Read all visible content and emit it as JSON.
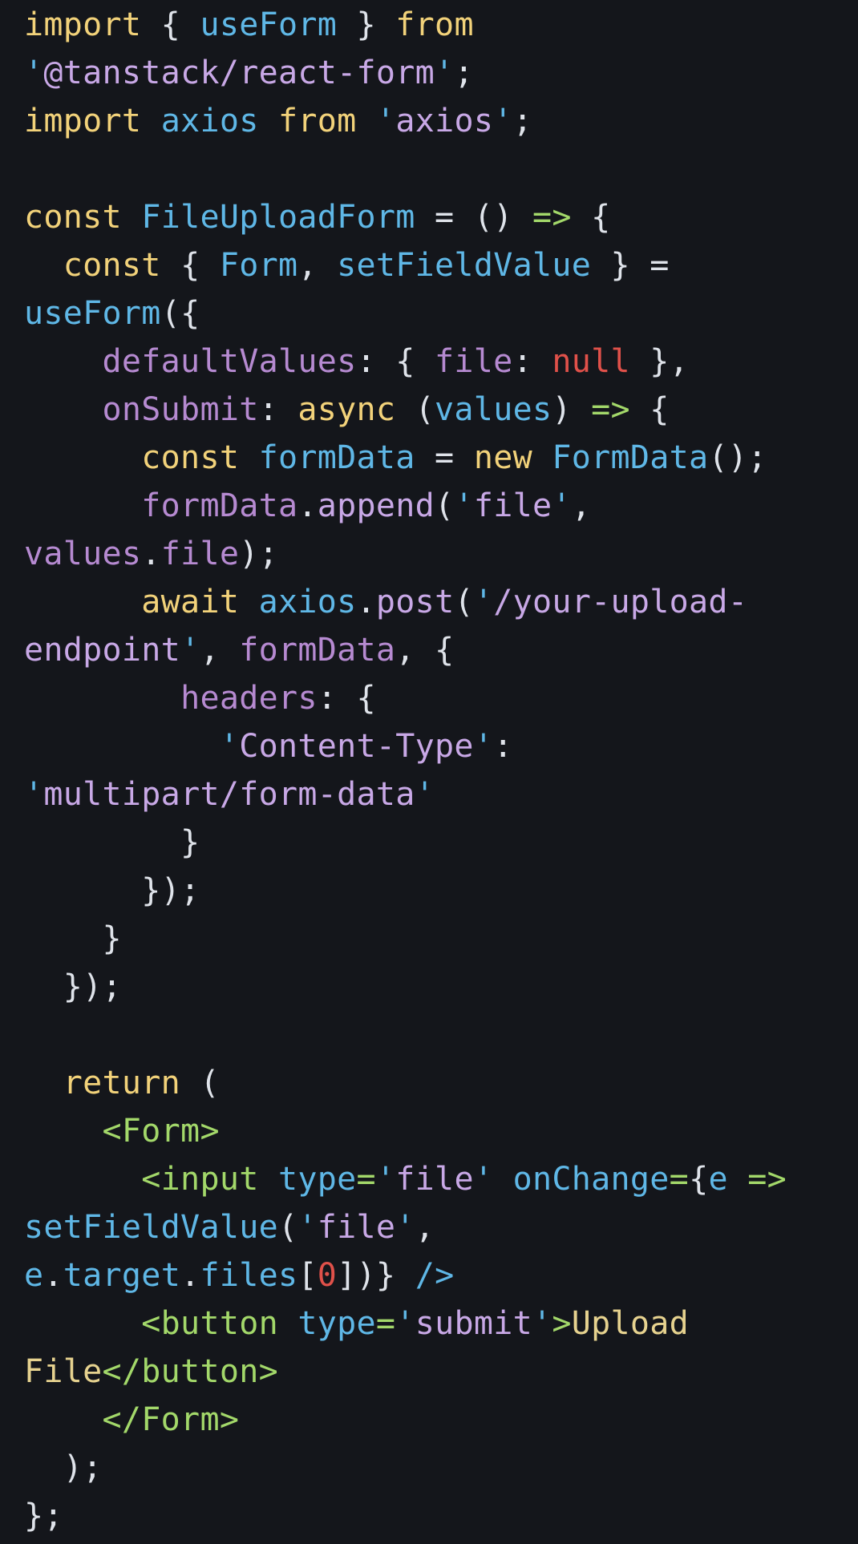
{
  "editor": {
    "background": "#14161b",
    "colors": {
      "keyword": "#f2d27a",
      "identifier": "#5fb7e6",
      "string": "#c8a8e6",
      "property": "#b68ad1",
      "null": "#e0514a",
      "jsx_tag": "#a3d86a",
      "punctuation": "#dfe3ea"
    },
    "lines": [
      [
        [
          "kw",
          "import"
        ],
        [
          "p",
          " { "
        ],
        [
          "id",
          "useForm"
        ],
        [
          "p",
          " } "
        ],
        [
          "kw",
          "from"
        ]
      ],
      [
        [
          "q",
          "'"
        ],
        [
          "s",
          "@tanstack/react-form"
        ],
        [
          "q",
          "'"
        ],
        [
          "p",
          ";"
        ]
      ],
      [
        [
          "kw",
          "import"
        ],
        [
          "p",
          " "
        ],
        [
          "id",
          "axios"
        ],
        [
          "p",
          " "
        ],
        [
          "kw",
          "from"
        ],
        [
          "p",
          " "
        ],
        [
          "q",
          "'"
        ],
        [
          "s",
          "axios"
        ],
        [
          "q",
          "'"
        ],
        [
          "p",
          ";"
        ]
      ],
      [],
      [
        [
          "kw",
          "const"
        ],
        [
          "p",
          " "
        ],
        [
          "id",
          "FileUploadForm"
        ],
        [
          "p",
          " = () "
        ],
        [
          "ar",
          "=>"
        ],
        [
          "p",
          " {"
        ]
      ],
      [
        [
          "p",
          "  "
        ],
        [
          "kw",
          "const"
        ],
        [
          "p",
          " { "
        ],
        [
          "id",
          "Form"
        ],
        [
          "p",
          ", "
        ],
        [
          "id",
          "setFieldValue"
        ],
        [
          "p",
          " } ="
        ]
      ],
      [
        [
          "id",
          "useForm"
        ],
        [
          "p",
          "({"
        ]
      ],
      [
        [
          "p",
          "    "
        ],
        [
          "pr",
          "defaultValues"
        ],
        [
          "p",
          ": { "
        ],
        [
          "pr",
          "file"
        ],
        [
          "p",
          ": "
        ],
        [
          "nu",
          "null"
        ],
        [
          "p",
          " },"
        ]
      ],
      [
        [
          "p",
          "    "
        ],
        [
          "pr",
          "onSubmit"
        ],
        [
          "p",
          ": "
        ],
        [
          "kw",
          "async"
        ],
        [
          "p",
          " ("
        ],
        [
          "id",
          "values"
        ],
        [
          "p",
          ") "
        ],
        [
          "ar",
          "=>"
        ],
        [
          "p",
          " {"
        ]
      ],
      [
        [
          "p",
          "      "
        ],
        [
          "kw",
          "const"
        ],
        [
          "p",
          " "
        ],
        [
          "id",
          "formData"
        ],
        [
          "p",
          " = "
        ],
        [
          "kw",
          "new"
        ],
        [
          "p",
          " "
        ],
        [
          "id",
          "FormData"
        ],
        [
          "p",
          "();"
        ]
      ],
      [
        [
          "p",
          "      "
        ],
        [
          "pr",
          "formData"
        ],
        [
          "p",
          "."
        ],
        [
          "m",
          "append"
        ],
        [
          "p",
          "("
        ],
        [
          "q",
          "'"
        ],
        [
          "s",
          "file"
        ],
        [
          "q",
          "'"
        ],
        [
          "p",
          ","
        ]
      ],
      [
        [
          "pr",
          "values"
        ],
        [
          "p",
          "."
        ],
        [
          "pr",
          "file"
        ],
        [
          "p",
          ");"
        ]
      ],
      [
        [
          "p",
          "      "
        ],
        [
          "kw",
          "await"
        ],
        [
          "p",
          " "
        ],
        [
          "id",
          "axios"
        ],
        [
          "p",
          "."
        ],
        [
          "m",
          "post"
        ],
        [
          "p",
          "("
        ],
        [
          "q",
          "'"
        ],
        [
          "s",
          "/your-upload-"
        ]
      ],
      [
        [
          "s",
          "endpoint"
        ],
        [
          "q",
          "'"
        ],
        [
          "p",
          ", "
        ],
        [
          "pr",
          "formData"
        ],
        [
          "p",
          ", {"
        ]
      ],
      [
        [
          "p",
          "        "
        ],
        [
          "pr",
          "headers"
        ],
        [
          "p",
          ": {"
        ]
      ],
      [
        [
          "p",
          "          "
        ],
        [
          "q",
          "'"
        ],
        [
          "s",
          "Content-Type"
        ],
        [
          "q",
          "'"
        ],
        [
          "p",
          ":"
        ]
      ],
      [
        [
          "q",
          "'"
        ],
        [
          "s",
          "multipart/form-data"
        ],
        [
          "q",
          "'"
        ]
      ],
      [
        [
          "p",
          "        }"
        ]
      ],
      [
        [
          "p",
          "      });"
        ]
      ],
      [
        [
          "p",
          "    }"
        ]
      ],
      [
        [
          "p",
          "  });"
        ]
      ],
      [],
      [
        [
          "p",
          "  "
        ],
        [
          "kw",
          "return"
        ],
        [
          "p",
          " ("
        ]
      ],
      [
        [
          "p",
          "    "
        ],
        [
          "tg",
          "<Form>"
        ]
      ],
      [
        [
          "p",
          "      "
        ],
        [
          "tg",
          "<input"
        ],
        [
          "p",
          " "
        ],
        [
          "id",
          "type"
        ],
        [
          "tg",
          "="
        ],
        [
          "q",
          "'"
        ],
        [
          "s",
          "file"
        ],
        [
          "q",
          "'"
        ],
        [
          "p",
          " "
        ],
        [
          "id",
          "onChange"
        ],
        [
          "tg",
          "="
        ],
        [
          "p",
          "{"
        ],
        [
          "id",
          "e"
        ],
        [
          "p",
          " "
        ],
        [
          "ar",
          "=>"
        ]
      ],
      [
        [
          "id",
          "setFieldValue"
        ],
        [
          "p",
          "("
        ],
        [
          "q",
          "'"
        ],
        [
          "s",
          "file"
        ],
        [
          "q",
          "'"
        ],
        [
          "p",
          ","
        ]
      ],
      [
        [
          "id",
          "e"
        ],
        [
          "p",
          "."
        ],
        [
          "id",
          "target"
        ],
        [
          "p",
          "."
        ],
        [
          "id",
          "files"
        ],
        [
          "p",
          "["
        ],
        [
          "num",
          "0"
        ],
        [
          "p",
          "])} "
        ],
        [
          "id",
          "/>"
        ]
      ],
      [
        [
          "p",
          "      "
        ],
        [
          "tg",
          "<button"
        ],
        [
          "p",
          " "
        ],
        [
          "id",
          "type"
        ],
        [
          "tg",
          "="
        ],
        [
          "q",
          "'"
        ],
        [
          "s",
          "submit"
        ],
        [
          "q",
          "'"
        ],
        [
          "tg",
          ">"
        ],
        [
          "tx",
          "Upload"
        ]
      ],
      [
        [
          "tx",
          "File"
        ],
        [
          "tg",
          "</button>"
        ]
      ],
      [
        [
          "p",
          "    "
        ],
        [
          "tg",
          "</Form>"
        ]
      ],
      [
        [
          "p",
          "  );"
        ]
      ],
      [
        [
          "p",
          "};"
        ]
      ]
    ]
  }
}
